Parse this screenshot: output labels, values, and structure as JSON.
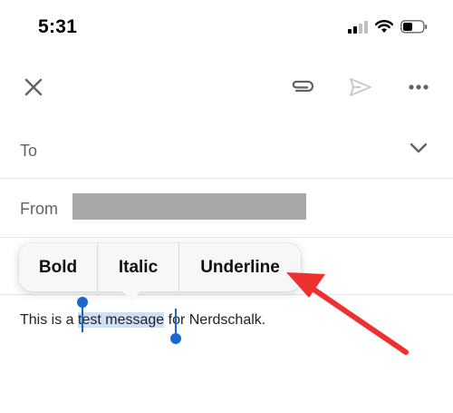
{
  "status_bar": {
    "time": "5:31"
  },
  "compose": {
    "to_label": "To",
    "from_label": "From"
  },
  "format_menu": {
    "bold": "Bold",
    "italic": "Italic",
    "underline": "Underline"
  },
  "message": {
    "before": "This is a ",
    "selected": "test message",
    "after": " for Nerdschalk."
  },
  "colors": {
    "selection": "#cfe0f5",
    "handle": "#1a67d2",
    "annotation_arrow": "#ee3030"
  }
}
